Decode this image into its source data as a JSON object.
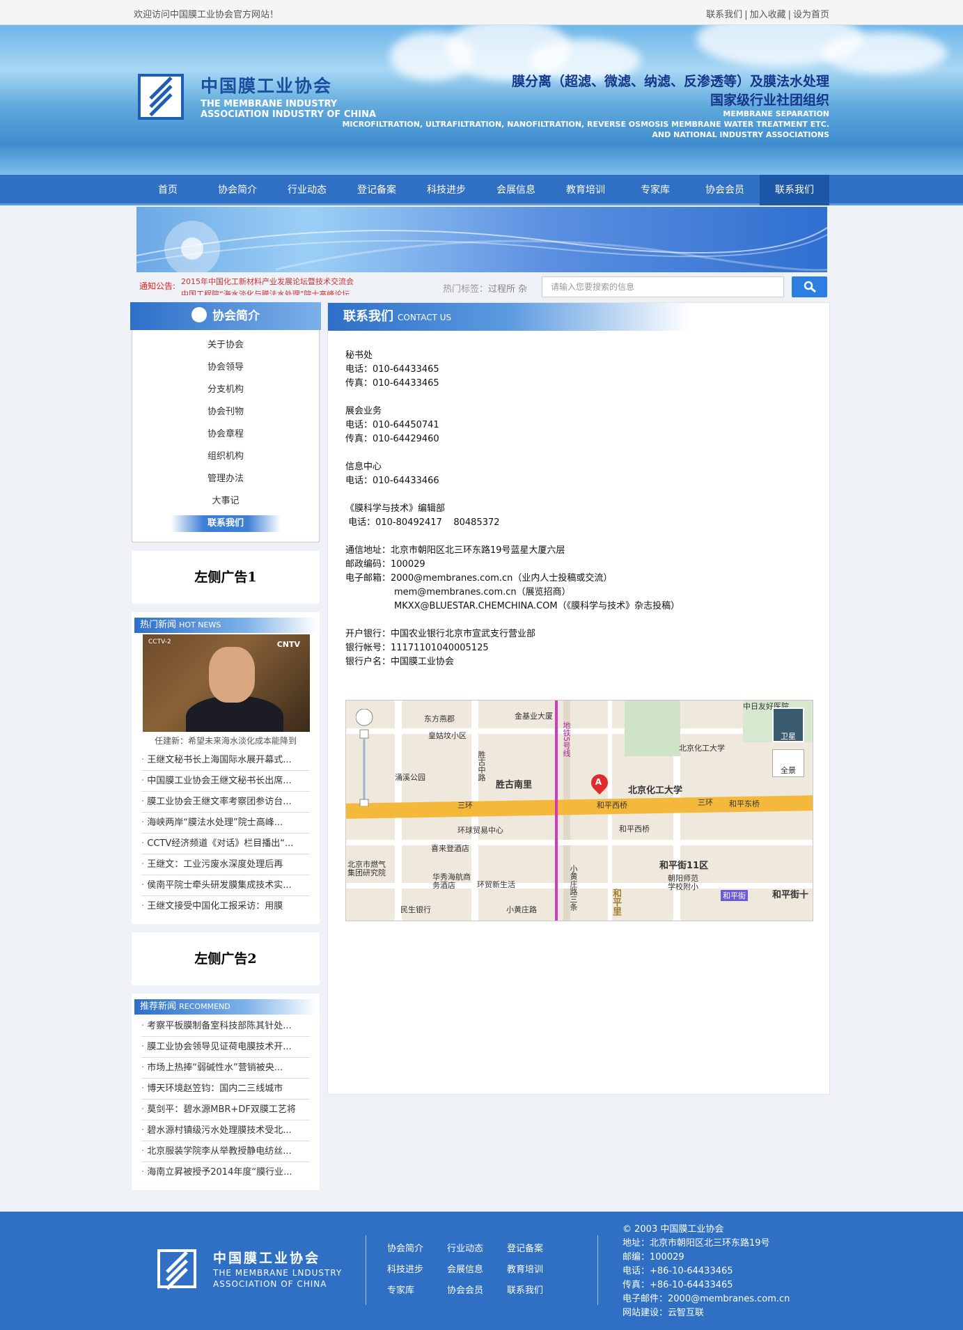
{
  "topbar": {
    "welcome": "欢迎访问中国膜工业协会官方网站！",
    "links": [
      "联系我们",
      "加入收藏",
      "设为首页"
    ]
  },
  "banner": {
    "logo_cn": "中国膜工业协会",
    "logo_en_1": "THE MEMBRANE INDUSTRY",
    "logo_en_2": "ASSOCIATION INDUSTRY OF CHINA",
    "line1": "膜分离（超滤、微滤、纳滤、反渗透等）及膜法水处理",
    "line2": "国家级行业社团组织",
    "line3": "MEMBRANE SEPARATION",
    "line4": "MICROFILTRATION, ULTRAFILTRATION, NANOFILTRATION, REVERSE OSMOSIS MEMBRANE WATER TREATMENT ETC.",
    "line5": "AND NATIONAL INDUSTRY ASSOCIATIONS"
  },
  "nav": [
    "首页",
    "协会简介",
    "行业动态",
    "登记备案",
    "科技进步",
    "会展信息",
    "教育培训",
    "专家库",
    "协会会员",
    "联系我们"
  ],
  "notice": {
    "label": "通知公告:",
    "text1": "2015年中国化工新材料产业发展论坛暨技术交流会",
    "text2": "中国工程院“海水淡化与膜法水处理”院士高峰论坛"
  },
  "search": {
    "hot_label": "热门标签：",
    "hot_tags": "过程所 杂",
    "placeholder": "请输入您要搜索的信息"
  },
  "sidebar": {
    "title": "协会简介",
    "items": [
      "关于协会",
      "协会领导",
      "分支机构",
      "协会刊物",
      "协会章程",
      "组织机构",
      "管理办法",
      "大事记",
      "联系我们"
    ],
    "ad1": "左侧广告1",
    "ad2": "左侧广告2",
    "hot": {
      "title": "热门新闻",
      "title_en": "HOT NEWS",
      "photo_caption": "任建新：希望未来海水淡化成本能降到",
      "items": [
        "王继文秘书长上海国际水展开幕式...",
        "中国膜工业协会王继文秘书长出席...",
        "膜工业协会王继文率考察团参访台...",
        "海峡两岸“膜法水处理”院士高峰...",
        "CCTV经济频道《对话》栏目播出“...",
        "王继文：工业污废水深度处理后再",
        "侯南平院士牵头研发膜集成技术实...",
        "王继文接受中国化工报采访：用膜"
      ]
    },
    "recommend": {
      "title": "推荐新闻",
      "title_en": "RECOMMEND",
      "items": [
        "考察平板膜制备室科技部陈其针处...",
        "膜工业协会领导见证荷电膜技术开...",
        "市场上热捧“弱碱性水”营销被央...",
        "博天环境赵笠钧：国内二三线城市",
        "莫剑平：碧水源MBR+DF双膜工艺将",
        "碧水源村镇级污水处理膜技术受北...",
        "北京服装学院李从举教授静电纺丝...",
        "海南立昇被授予2014年度“膜行业..."
      ]
    }
  },
  "main": {
    "title": "联系我们",
    "title_en": "CONTACT US",
    "sec1": {
      "name": "秘书处",
      "tel": "电话：010-64433465",
      "fax": "传真：010-64433465"
    },
    "sec2": {
      "name": "展会业务",
      "tel": "电话：010-64450741",
      "fax": "传真：010-64429460"
    },
    "sec3": {
      "name": "信息中心",
      "tel": "电话：010-64433466"
    },
    "sec4": {
      "name": "《膜科学与技术》编辑部",
      "tel": " 电话：010-80492417    80485372"
    },
    "address": "通信地址：北京市朝阳区北三环东路19号蓝星大厦六层",
    "postcode": "邮政编码：100029",
    "email1": "电子邮箱：2000@membranes.com.cn（业内人士投稿或交流）",
    "email2": "mem@membranes.com.cn（展览招商）",
    "email3": "MKXX@BLUESTAR.CHEMCHINA.COM（《膜科学与技术》杂志投稿）",
    "bank": "开户银行：中国农业银行北京市宣武支行营业部",
    "account": "银行帐号：11171101040005125",
    "account_name": "银行户名：中国膜工业协会"
  },
  "map": {
    "labels": [
      "东方燕郡",
      "金基业大厦",
      "皇姑坟小区",
      "胜古中路",
      "涌溪公园",
      "胜古南里",
      "北京化工大学",
      "北京化工大学",
      "三环",
      "三环",
      "和平西桥",
      "和平东桥",
      "环球贸易中心",
      "和平西桥",
      "喜来登酒店",
      "北京市燃气集团研究院",
      "华秀海航商务酒店",
      "环贸新生活",
      "和平街11区",
      "朝阳师范学校附小",
      "和平街",
      "和平街十",
      "民生银行",
      "小黄庄路",
      "小黄庄路三条",
      "中日友好医院",
      "地铁5号线",
      "和平里"
    ],
    "marker": "A",
    "satellite": "卫星",
    "panorama": "全景"
  },
  "footer": {
    "logo_cn": "中国膜工业协会",
    "logo_en_1": "THE MEMBRANE LNDUSTRY",
    "logo_en_2": "ASSOCIATION OF CHINA",
    "links": [
      "协会简介",
      "行业动态",
      "登记备案",
      "科技进步",
      "会展信息",
      "教育培训",
      "专家库",
      "协会会员",
      "联系我们"
    ],
    "copyright": "© 2003 中国膜工业协会",
    "address": "地址：北京市朝阳区北三环东路19号",
    "postcode": "邮编：100029",
    "tel": "电话：+86-10-64433465",
    "fax": "传真：+86-10-64433465",
    "email": "电子邮件：2000@membranes.com.cn",
    "builder": "网站建设：云智互联"
  },
  "colors": {
    "primary": "#2f6fc4",
    "accent": "#2c7fe2",
    "notice": "#d22222"
  }
}
